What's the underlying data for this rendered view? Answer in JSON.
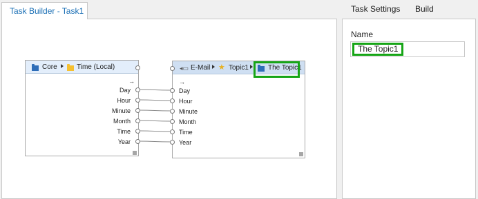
{
  "tabs": {
    "task_builder": "Task Builder - Task1",
    "task_settings": "Task Settings",
    "build": "Build"
  },
  "settings": {
    "name_label": "Name",
    "name_value": "The Topic1"
  },
  "source_node": {
    "breadcrumb": [
      "Core",
      "Time (Local)"
    ],
    "flow_arrow": "→",
    "ports": [
      "Day",
      "Hour",
      "Minute",
      "Month",
      "Time",
      "Year"
    ]
  },
  "target_node": {
    "breadcrumb": [
      "E-Mail",
      "Topic1",
      "The Topic1"
    ],
    "flow_arrow": "→",
    "ports": [
      "Day",
      "Hour",
      "Minute",
      "Month",
      "Time",
      "Year"
    ]
  },
  "colors": {
    "accent": "#1a6fb5",
    "highlight": "#16a516",
    "source_header": "#e3eefb",
    "target_header": "#cfdff2",
    "folder_blue": "#2e6db8",
    "folder_yellow": "#f5c030"
  },
  "connections": [
    [
      "Day",
      "Day"
    ],
    [
      "Hour",
      "Hour"
    ],
    [
      "Minute",
      "Minute"
    ],
    [
      "Month",
      "Month"
    ],
    [
      "Time",
      "Time"
    ],
    [
      "Year",
      "Year"
    ]
  ]
}
